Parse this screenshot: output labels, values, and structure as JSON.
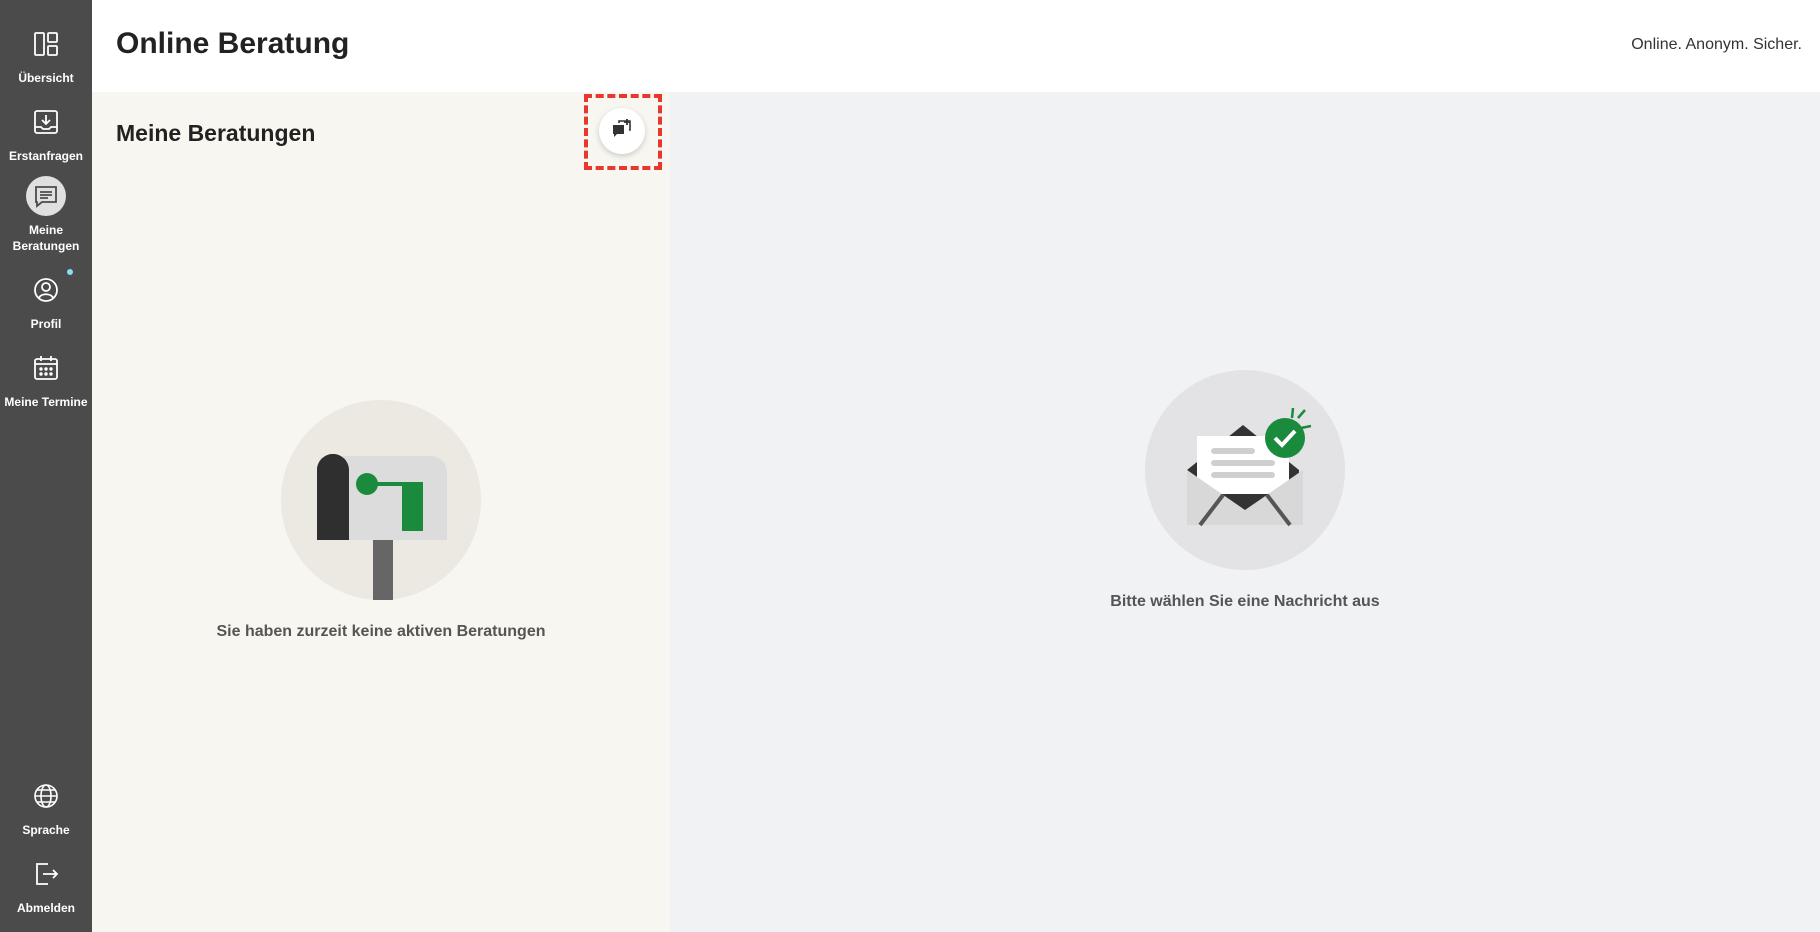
{
  "sidebar": {
    "items": [
      {
        "label": "Übersicht",
        "icon": "dashboard-icon"
      },
      {
        "label": "Erstanfragen",
        "icon": "inbox-download-icon"
      },
      {
        "label": "Meine Beratungen",
        "icon": "chat-icon",
        "active": true
      },
      {
        "label": "Profil",
        "icon": "profile-icon",
        "notification": true
      },
      {
        "label": "Meine Termine",
        "icon": "calendar-icon"
      }
    ],
    "bottom_items": [
      {
        "label": "Sprache",
        "icon": "globe-icon"
      },
      {
        "label": "Abmelden",
        "icon": "logout-icon"
      }
    ]
  },
  "header": {
    "title": "Online Beratung",
    "claim": "Online. Anonym. Sicher."
  },
  "left_panel": {
    "title": "Meine Beratungen",
    "new_button_icon": "new-chat-icon",
    "empty_text": "Sie haben zurzeit keine aktiven Beratungen"
  },
  "right_panel": {
    "empty_text": "Bitte wählen Sie eine Nachricht aus"
  },
  "colors": {
    "sidebar_bg": "#4b4b4b",
    "accent_green": "#1a8a3c",
    "highlight_red": "#e8372c",
    "left_panel_bg": "#f8f6f0",
    "right_panel_bg": "#f1f2f4"
  }
}
